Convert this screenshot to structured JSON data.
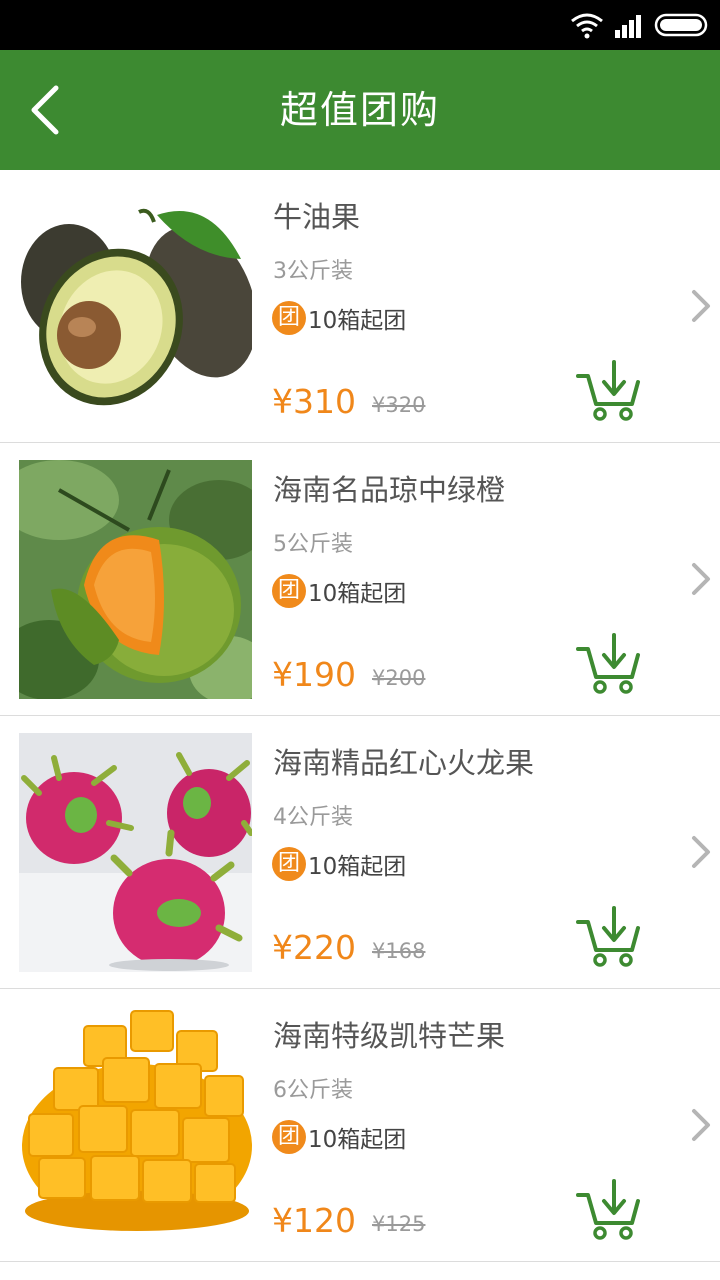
{
  "header": {
    "title": "超值团购"
  },
  "products": [
    {
      "name": "牛油果",
      "spec": "3公斤装",
      "badge_icon": "团",
      "group_text": "10箱起团",
      "price": "¥310",
      "original_price": "¥320"
    },
    {
      "name": "海南名品琼中绿橙",
      "spec": "5公斤装",
      "badge_icon": "团",
      "group_text": "10箱起团",
      "price": "¥190",
      "original_price": "¥200"
    },
    {
      "name": "海南精品红心火龙果",
      "spec": "4公斤装",
      "badge_icon": "团",
      "group_text": "10箱起团",
      "price": "¥220",
      "original_price": "¥168"
    },
    {
      "name": "海南特级凯特芒果",
      "spec": "6公斤装",
      "badge_icon": "团",
      "group_text": "10箱起团",
      "price": "¥120",
      "original_price": "¥125"
    }
  ],
  "icons": {
    "back": "back-arrow-icon",
    "cart": "add-to-cart-icon",
    "chevron": "chevron-right-icon"
  },
  "colors": {
    "header": "#3d8a31",
    "price": "#f0871a",
    "badge": "#f08a1b",
    "cart": "#3d8a31"
  }
}
